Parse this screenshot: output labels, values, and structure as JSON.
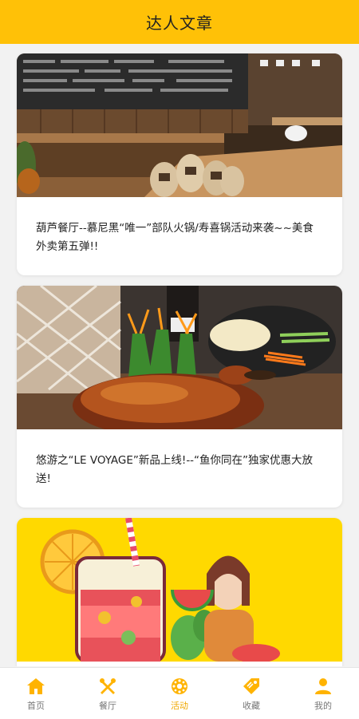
{
  "header": {
    "title": "达人文章"
  },
  "articles": [
    {
      "title": "葫芦餐厅--慕尼黑“唯一”部队火锅/寿喜锅活动来袭~~美食外卖第五弹!!"
    },
    {
      "title": "悠游之“LE VOYAGE”新品上线!--“鱼你同在”独家优惠大放送!"
    },
    {
      "title": ""
    }
  ],
  "tabbar": {
    "active": "活动",
    "items": [
      {
        "label": "首页",
        "icon": "home-icon"
      },
      {
        "label": "餐厅",
        "icon": "utensils-icon"
      },
      {
        "label": "活动",
        "icon": "ball-icon"
      },
      {
        "label": "收藏",
        "icon": "tag-icon"
      },
      {
        "label": "我的",
        "icon": "user-icon"
      }
    ]
  },
  "colors": {
    "brand": "#FFC107",
    "active": "#F0A800",
    "icon": "#FFB300"
  }
}
